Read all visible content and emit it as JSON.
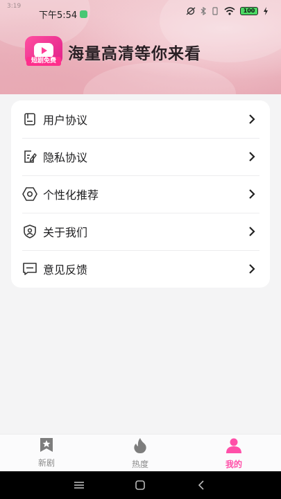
{
  "status_bar": {
    "corner_text": "3:19",
    "time": "下午5:54",
    "battery": "100"
  },
  "header": {
    "logo_badge": "短剧免费",
    "slogan": "海量高清等你来看"
  },
  "menu": {
    "items": [
      {
        "label": "用户协议",
        "icon": "document-icon"
      },
      {
        "label": "隐私协议",
        "icon": "edit-document-icon"
      },
      {
        "label": "个性化推荐",
        "icon": "gear-icon"
      },
      {
        "label": "关于我们",
        "icon": "shield-user-icon"
      },
      {
        "label": "意见反馈",
        "icon": "message-icon"
      }
    ]
  },
  "tabbar": {
    "tabs": [
      {
        "label": "新剧",
        "icon": "star-bookmark-icon",
        "active": false
      },
      {
        "label": "热度",
        "icon": "flame-icon",
        "active": false
      },
      {
        "label": "我的",
        "icon": "user-icon",
        "active": true
      }
    ]
  },
  "colors": {
    "accent": "#ff4fa8",
    "tab_inactive": "#8a8a8a"
  }
}
